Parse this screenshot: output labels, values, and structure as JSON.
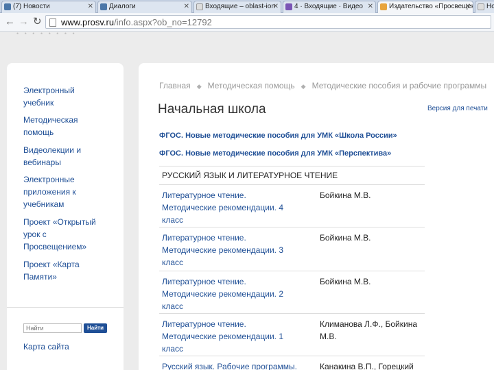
{
  "browser": {
    "tabs": [
      {
        "title": "(7) Новости",
        "favicon_color": "#4a76a8"
      },
      {
        "title": "Диалоги",
        "favicon_color": "#4a76a8"
      },
      {
        "title": "Входящие – oblast-ion",
        "favicon_color": "#dddddd"
      },
      {
        "title": "4 · Входящие · Видео",
        "favicon_color": "#7a55b5"
      },
      {
        "title": "Издательство «Просвещение»",
        "favicon_color": "#e8a43c"
      },
      {
        "title": "Новая",
        "favicon_color": "#dddddd"
      }
    ],
    "url_host": "www.prosv.ru",
    "url_path": "/info.aspx?ob_no=12792"
  },
  "faded_nav": "• • • • • • • •",
  "sidebar": {
    "items": [
      "Электронный учебник",
      "Методическая помощь",
      "Видеолекции и вебинары",
      "Электронные приложения к учебникам",
      "Проект «Открытый урок с Просвещением»",
      "Проект «Карта Памяти»"
    ],
    "search_placeholder": "Найти",
    "search_button": "Найти",
    "sitemap": "Карта сайта"
  },
  "main": {
    "breadcrumbs": [
      "Главная",
      "Методическая помощь",
      "Методические пособия и рабочие программы"
    ],
    "crumb_sep": "◆",
    "title": "Начальная школа",
    "print_link": "Версия для печати",
    "fgos_links": [
      "ФГОС. Новые методические пособия для УМК «Школа России»",
      "ФГОС. Новые методические пособия для УМК «Перспектива»"
    ],
    "section_title": "РУССКИЙ ЯЗЫК И ЛИТЕРАТУРНОЕ ЧТЕНИЕ",
    "rows": [
      {
        "title": "Литературное чтение. Методические рекомендации. 4 класс",
        "author": "Бойкина М.В."
      },
      {
        "title": "Литературное чтение. Методические рекомендации. 3 класс",
        "author": "Бойкина М.В."
      },
      {
        "title": "Литературное чтение. Методические рекомендации. 2 класс",
        "author": "Бойкина М.В."
      },
      {
        "title": "Литературное чтение. Методические рекомендации. 1 класс",
        "author": "Климанова Л.Ф., Бойкина М.В."
      },
      {
        "title": "Русский язык. Рабочие программы.",
        "author": "Канакина В.П., Горецкий"
      }
    ]
  },
  "colors": {
    "link": "#1f4f96",
    "background": "#ececec"
  }
}
